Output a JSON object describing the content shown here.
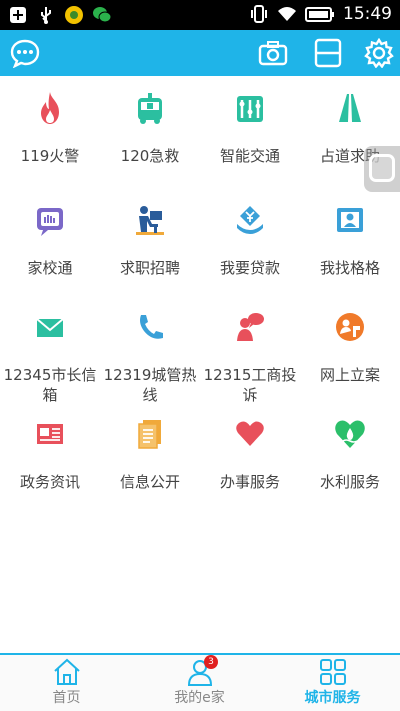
{
  "status_bar": {
    "time": "15:49",
    "icons": [
      "add-icon",
      "usb-icon",
      "app-icon",
      "wechat-icon",
      "vibrate-icon",
      "wifi-icon",
      "battery-icon"
    ]
  },
  "header": {
    "icons": [
      "chat-bubble-icon",
      "camera-icon",
      "scan-icon",
      "settings-icon"
    ],
    "accent": "#1fb4e8"
  },
  "services": [
    {
      "label": "119火警",
      "icon": "fire-icon",
      "color": "#e8505b"
    },
    {
      "label": "120急救",
      "icon": "ambulance-icon",
      "color": "#2bbfa0"
    },
    {
      "label": "智能交通",
      "icon": "traffic-icon",
      "color": "#2bbfa0"
    },
    {
      "label": "占道求助",
      "icon": "road-icon",
      "color": "#2bbfa0"
    },
    {
      "label": "家校通",
      "icon": "school-icon",
      "color": "#7b68c8"
    },
    {
      "label": "求职招聘",
      "icon": "job-icon",
      "color": "#2a5c9a"
    },
    {
      "label": "我要贷款",
      "icon": "loan-icon",
      "color": "#3aa0d8"
    },
    {
      "label": "我找格格",
      "icon": "contact-card-icon",
      "color": "#3aa0d8"
    },
    {
      "label": "12345市长信箱",
      "icon": "mail-icon",
      "color": "#2bbfa0"
    },
    {
      "label": "12319城管热线",
      "icon": "phone-icon",
      "color": "#3aa0d8"
    },
    {
      "label": "12315工商投诉",
      "icon": "complaint-icon",
      "color": "#e8505b"
    },
    {
      "label": "网上立案",
      "icon": "case-filing-icon",
      "color": "#f07a2a"
    },
    {
      "label": "政务资讯",
      "icon": "news-icon",
      "color": "#e8505b"
    },
    {
      "label": "信息公开",
      "icon": "document-icon",
      "color": "#f0a93a"
    },
    {
      "label": "办事服务",
      "icon": "heart-icon",
      "color": "#e8505b"
    },
    {
      "label": "水利服务",
      "icon": "water-heart-icon",
      "color": "#2bbf6a"
    }
  ],
  "bottom_nav": {
    "tabs": [
      {
        "label": "首页",
        "icon": "home-icon"
      },
      {
        "label": "我的e家",
        "icon": "user-icon",
        "badge": "3"
      },
      {
        "label": "城市服务",
        "icon": "grid-icon"
      }
    ],
    "active": "城市服务"
  }
}
